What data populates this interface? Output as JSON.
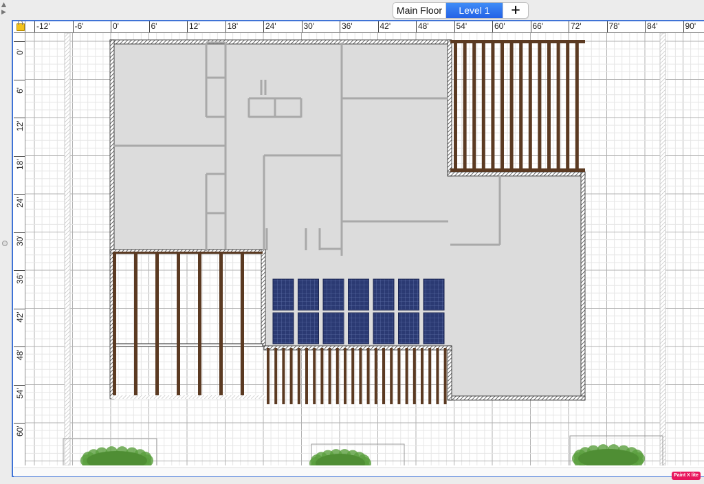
{
  "tabs": [
    {
      "label": "Main Floor",
      "selected": false
    },
    {
      "label": "Level 1",
      "selected": true
    }
  ],
  "add_tab_symbol": "+",
  "ruler_x_labels": [
    "-12'",
    "-6'",
    "0'",
    "6'",
    "12'",
    "18'",
    "24'",
    "30'",
    "36'",
    "42'",
    "48'",
    "54'",
    "60'",
    "66'",
    "72'",
    "78'",
    "84'",
    "90'"
  ],
  "ruler_y_labels": [
    "0'",
    "6'",
    "12'",
    "18'",
    "24'",
    "30'",
    "36'",
    "42'",
    "48'",
    "54'",
    "60'"
  ],
  "icons": {
    "lock": "lock-icon",
    "add_level": "plus-icon",
    "collapse": "triangle-up-icon",
    "expand": "triangle-right-icon"
  },
  "colors": {
    "selected_tab": "#2f74ef",
    "frame": "#3f73d6",
    "floor": "#dcdcdc",
    "pergola": "#5b3a22",
    "solar_panel": "#2b3a73",
    "plants": "#5a9f3d",
    "badge": "#e8175d"
  },
  "badge_text": "Paint X lite"
}
